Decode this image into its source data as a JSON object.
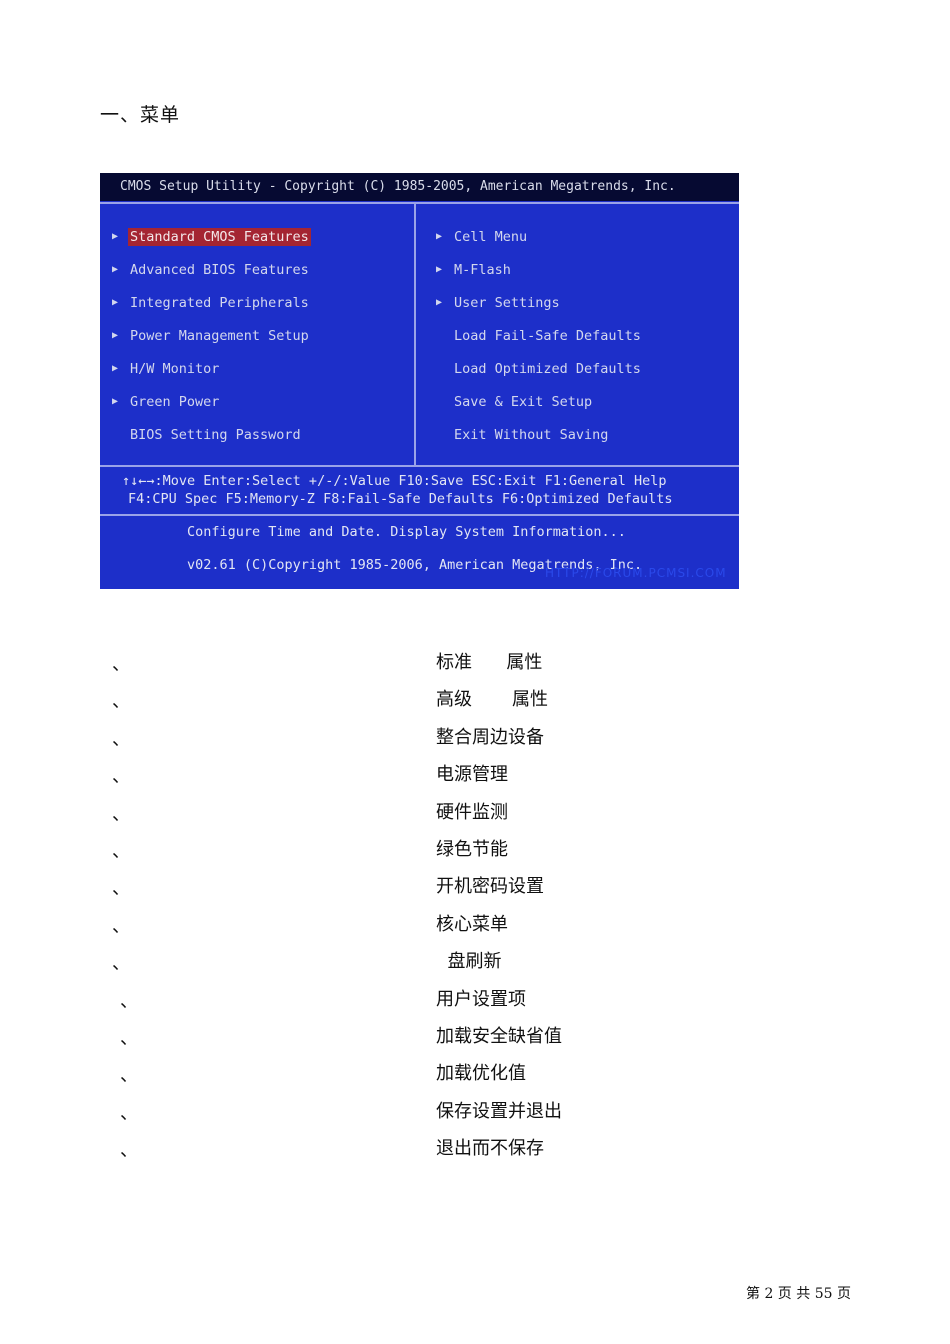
{
  "heading": "一、菜单",
  "bios": {
    "title": "CMOS Setup Utility - Copyright (C) 1985-2005, American Megatrends, Inc.",
    "left_menu": [
      {
        "label": "Standard CMOS Features",
        "arrow": "▶"
      },
      {
        "label": "Advanced BIOS Features",
        "arrow": "▶"
      },
      {
        "label": "Integrated Peripherals",
        "arrow": "▶"
      },
      {
        "label": "Power Management Setup",
        "arrow": "▶"
      },
      {
        "label": "H/W Monitor",
        "arrow": "▶"
      },
      {
        "label": "Green Power",
        "arrow": "▶"
      },
      {
        "label": "BIOS Setting Password",
        "arrow": ""
      }
    ],
    "right_menu": [
      {
        "label": "Cell Menu",
        "arrow": "▶"
      },
      {
        "label": "M-Flash",
        "arrow": "▶"
      },
      {
        "label": "User Settings",
        "arrow": "▶"
      },
      {
        "label": "Load Fail-Safe Defaults",
        "arrow": ""
      },
      {
        "label": "Load Optimized Defaults",
        "arrow": ""
      },
      {
        "label": "Save & Exit Setup",
        "arrow": ""
      },
      {
        "label": "Exit Without Saving",
        "arrow": ""
      }
    ],
    "help_line1": "↑↓←→:Move  Enter:Select  +/-/:Value  F10:Save  ESC:Exit  F1:General Help",
    "help_line2": "F4:CPU Spec  F5:Memory-Z  F8:Fail-Safe Defaults  F6:Optimized Defaults",
    "description": "Configure Time and Date.  Display System Information...",
    "version": "v02.61 (C)Copyright 1985-2006, American Megatrends, Inc.",
    "watermark": "HTTP://FORUM.PCMSI.COM",
    "colors": {
      "background": "#1d2fc9",
      "title_bar": "#060a32",
      "highlight": "#a42532"
    }
  },
  "translations": [
    {
      "mark": "、",
      "zh": "标准      属性"
    },
    {
      "mark": "、",
      "zh": "高级       属性"
    },
    {
      "mark": "、",
      "zh": "整合周边设备"
    },
    {
      "mark": "、",
      "zh": "电源管理"
    },
    {
      "mark": "、",
      "zh": "硬件监测"
    },
    {
      "mark": "、",
      "zh": "绿色节能"
    },
    {
      "mark": "、",
      "zh": "开机密码设置"
    },
    {
      "mark": "、",
      "zh": "核心菜单"
    },
    {
      "mark": "、",
      "zh": "  盘刷新"
    },
    {
      "mark": "、",
      "zh": "用户设置项"
    },
    {
      "mark": "、",
      "zh": "加载安全缺省值"
    },
    {
      "mark": "、",
      "zh": "加载优化值"
    },
    {
      "mark": "、",
      "zh": "保存设置并退出"
    },
    {
      "mark": "、",
      "zh": "退出而不保存"
    }
  ],
  "footer": "第 2 页 共 55 页"
}
